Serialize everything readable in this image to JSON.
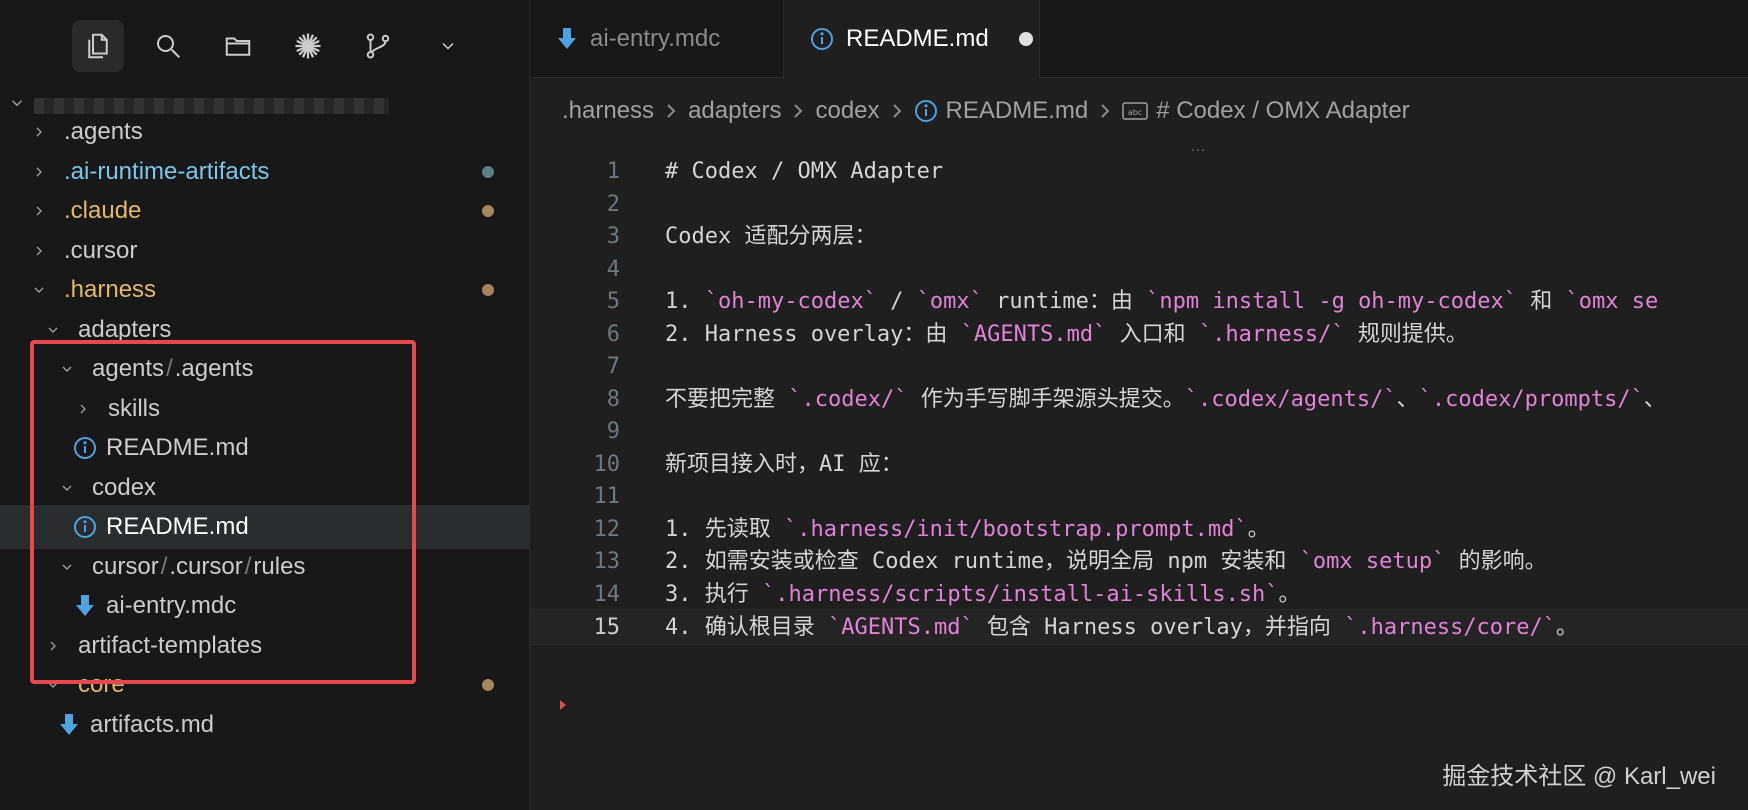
{
  "activity_bar": {
    "icons": [
      "files-icon",
      "search-icon",
      "folder-icon",
      "sparkle-icon",
      "source-control-icon",
      "chevron-down-icon"
    ]
  },
  "explorer": {
    "tree": [
      {
        "label": ".agents",
        "color": "#cccccc",
        "twisty": "right",
        "depth": 0,
        "dot": null
      },
      {
        "label": ".ai-runtime-artifacts",
        "color": "#7cc7e8",
        "twisty": "right",
        "depth": 0,
        "dot": "#5f7f86"
      },
      {
        "label": ".claude",
        "color": "#e2b86b",
        "twisty": "right",
        "depth": 0,
        "dot": "#a8845a"
      },
      {
        "label": ".cursor",
        "color": "#cccccc",
        "twisty": "right",
        "depth": 0,
        "dot": null
      },
      {
        "label": ".harness",
        "color": "#e2b86b",
        "twisty": "down",
        "depth": 0,
        "dot": "#a8845a"
      },
      {
        "label": "adapters",
        "color": "#cccccc",
        "twisty": "down",
        "depth": 1,
        "dot": null
      },
      {
        "label": "agents",
        "label2": ".agents",
        "color": "#cccccc",
        "twisty": "down",
        "depth": 2,
        "dot": null
      },
      {
        "label": "skills",
        "color": "#cccccc",
        "twisty": "right",
        "depth": 3,
        "dot": null
      },
      {
        "label": "README.md",
        "color": "#cccccc",
        "twisty": "none",
        "icon": "info-icon",
        "depth": 3,
        "dot": null
      },
      {
        "label": "codex",
        "color": "#cccccc",
        "twisty": "down",
        "depth": 2,
        "dot": null
      },
      {
        "label": "README.md",
        "color": "#ffffff",
        "twisty": "none",
        "icon": "info-icon",
        "depth": 3,
        "dot": null,
        "selected": true
      },
      {
        "label": "cursor",
        "label2": ".cursor",
        "label3": "rules",
        "color": "#cccccc",
        "twisty": "down",
        "depth": 2,
        "dot": null
      },
      {
        "label": "ai-entry.mdc",
        "color": "#cccccc",
        "twisty": "none",
        "icon": "download-icon",
        "depth": 3,
        "dot": null
      },
      {
        "label": "artifact-templates",
        "color": "#cccccc",
        "twisty": "right",
        "depth": 1,
        "dot": null
      },
      {
        "label": "core",
        "color": "#e2b86b",
        "twisty": "down",
        "depth": 1,
        "dot": "#a8845a"
      },
      {
        "label": "artifacts.md",
        "color": "#cccccc",
        "twisty": "none",
        "icon": "download-icon",
        "depth": 2,
        "dot": null
      }
    ]
  },
  "tabs": [
    {
      "label": "ai-entry.mdc",
      "active": false,
      "icon": "download-icon"
    },
    {
      "label": "README.md",
      "active": true,
      "icon": "info-icon",
      "modified": true
    }
  ],
  "breadcrumb": [
    ".harness",
    "adapters",
    "codex",
    "README.md",
    "# Codex / OMX Adapter"
  ],
  "editor": {
    "ellipsis": "…",
    "lines": [
      {
        "n": "1",
        "segs": [
          [
            "# Codex / OMX Adapter",
            ""
          ]
        ]
      },
      {
        "n": "2",
        "segs": []
      },
      {
        "n": "3",
        "segs": [
          [
            "Codex 适配分两层：",
            ""
          ]
        ]
      },
      {
        "n": "4",
        "segs": []
      },
      {
        "n": "5",
        "segs": [
          [
            "1. ",
            ""
          ],
          [
            "`oh-my-codex`",
            "pk"
          ],
          [
            " / ",
            ""
          ],
          [
            "`omx`",
            "pk"
          ],
          [
            " runtime：由 ",
            ""
          ],
          [
            "`npm install -g oh-my-codex`",
            "pk"
          ],
          [
            " 和 ",
            ""
          ],
          [
            "`omx se",
            "pk"
          ]
        ]
      },
      {
        "n": "6",
        "segs": [
          [
            "2. Harness overlay：由 ",
            ""
          ],
          [
            "`AGENTS.md`",
            "pk"
          ],
          [
            " 入口和 ",
            ""
          ],
          [
            "`.harness/`",
            "pk"
          ],
          [
            " 规则提供。",
            ""
          ]
        ]
      },
      {
        "n": "7",
        "segs": []
      },
      {
        "n": "8",
        "segs": [
          [
            "不要把完整 ",
            ""
          ],
          [
            "`.codex/`",
            "pk"
          ],
          [
            " 作为手写脚手架源头提交。",
            ""
          ],
          [
            "`.codex/agents/`",
            "pk"
          ],
          [
            "、",
            ""
          ],
          [
            "`.codex/prompts/`",
            "pk"
          ],
          [
            "、",
            ""
          ]
        ]
      },
      {
        "n": "9",
        "segs": []
      },
      {
        "n": "10",
        "segs": [
          [
            "新项目接入时，AI 应：",
            ""
          ]
        ]
      },
      {
        "n": "11",
        "segs": []
      },
      {
        "n": "12",
        "segs": [
          [
            "1. 先读取 ",
            ""
          ],
          [
            "`.harness/init/bootstrap.prompt.md`",
            "pk"
          ],
          [
            "。",
            ""
          ]
        ]
      },
      {
        "n": "13",
        "segs": [
          [
            "2. 如需安装或检查 Codex runtime，说明全局 npm 安装和 ",
            ""
          ],
          [
            "`omx setup`",
            "pk"
          ],
          [
            " 的影响。",
            ""
          ]
        ]
      },
      {
        "n": "14",
        "segs": [
          [
            "3. 执行 ",
            ""
          ],
          [
            "`.harness/scripts/install-ai-skills.sh`",
            "pk"
          ],
          [
            "。",
            ""
          ]
        ]
      },
      {
        "n": "15",
        "segs": [
          [
            "4. 确认根目录 ",
            ""
          ],
          [
            "`AGENTS.md`",
            "pk"
          ],
          [
            " 包含 Harness overlay，并指向 ",
            ""
          ],
          [
            "`.harness/core/`",
            "pk"
          ],
          [
            "。",
            ""
          ]
        ],
        "current": true
      }
    ]
  },
  "watermark": "掘金技术社区 @ Karl_wei"
}
